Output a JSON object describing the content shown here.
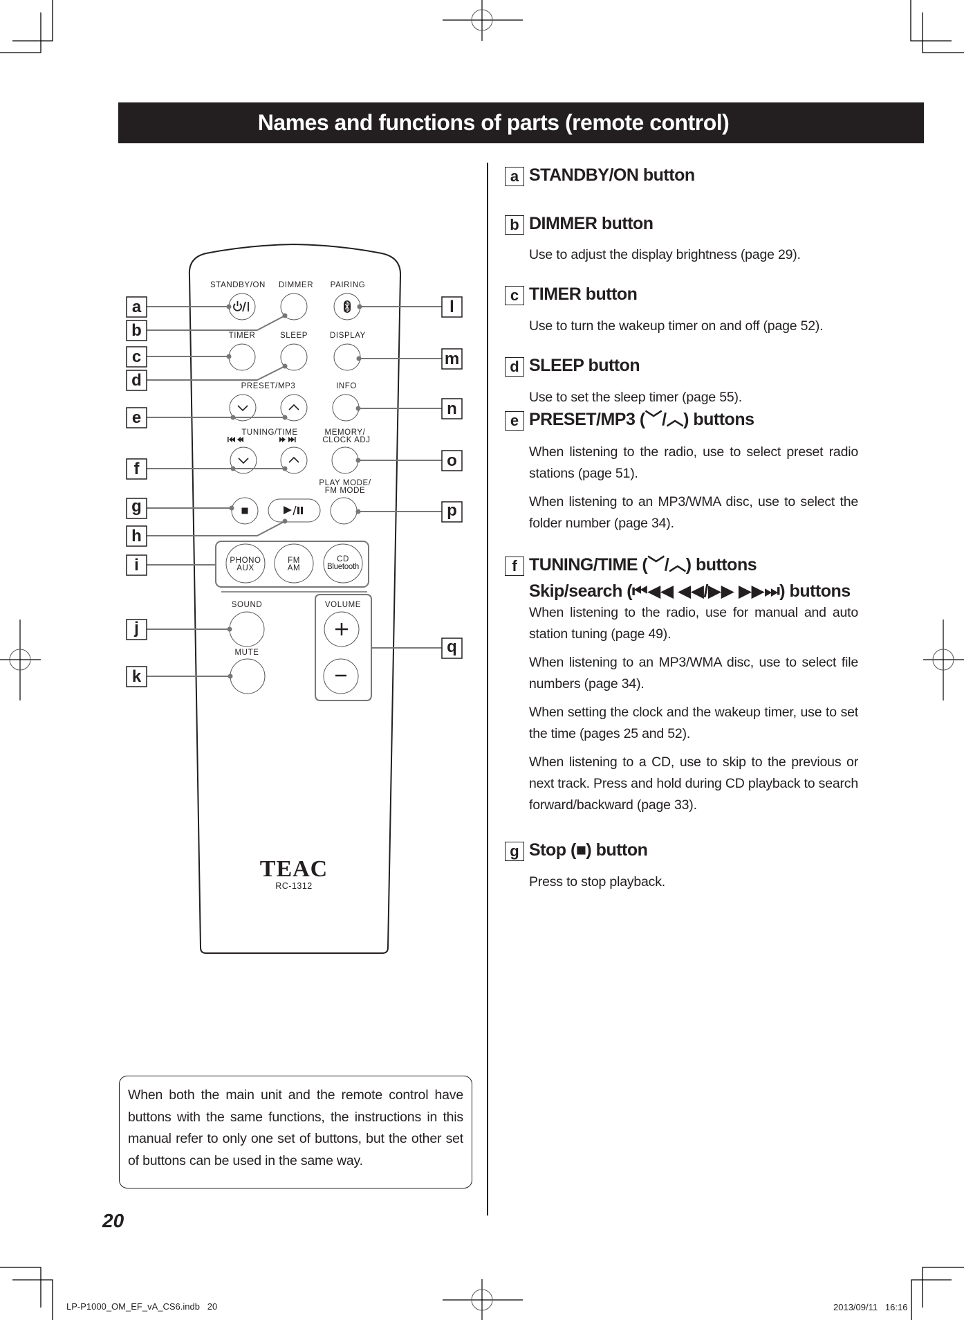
{
  "header": {
    "title": "Names and functions of parts (remote control)"
  },
  "remote": {
    "brand": "TEAC",
    "model": "RC-1312",
    "button_labels": {
      "standby_on": "STANDBY/ON",
      "dimmer": "DIMMER",
      "pairing": "PAIRING",
      "timer": "TIMER",
      "sleep": "SLEEP",
      "display": "DISPLAY",
      "preset_mp3": "PRESET/MP3",
      "info": "INFO",
      "tuning_time": "TUNING/TIME",
      "memory_clock_adj_1": "MEMORY/",
      "memory_clock_adj_2": "CLOCK ADJ",
      "play_mode_1": "PLAY MODE/",
      "play_mode_2": "FM MODE",
      "sound": "SOUND",
      "mute": "MUTE",
      "volume": "VOLUME",
      "phono_1": "PHONO",
      "phono_2": "AUX",
      "fm_1": "FM",
      "fm_2": "AM",
      "cd_1": "CD",
      "cd_2": "Bluetooth",
      "standby_glyph": "⏻/I",
      "skip_back_glyph": "⏮ ◀◀",
      "skip_fwd_glyph": "▶▶ ⏭",
      "play_pause_glyph": "▶/II",
      "plus_glyph": "+",
      "minus_glyph": "−"
    },
    "callouts": {
      "a": "a",
      "b": "b",
      "c": "c",
      "d": "d",
      "e": "e",
      "f": "f",
      "g": "g",
      "h": "h",
      "i": "i",
      "j": "j",
      "k": "k",
      "l": "l",
      "m": "m",
      "n": "n",
      "o": "o",
      "p": "p",
      "q": "q"
    }
  },
  "items": [
    {
      "letter": "a",
      "heading": "STANDBY/ON button",
      "body": []
    },
    {
      "letter": "b",
      "heading": "DIMMER button",
      "body": [
        "Use to adjust the display brightness (page 29)."
      ]
    },
    {
      "letter": "c",
      "heading": "TIMER button",
      "body": [
        "Use to turn the wakeup timer on and off (page 52)."
      ]
    },
    {
      "letter": "d",
      "heading": "SLEEP button",
      "body": [
        "Use to set the sleep timer (page 55)."
      ]
    },
    {
      "letter": "e",
      "heading": " PRESET/MP3 (﹀/︿) buttons",
      "body": [
        "When listening to the radio, use to select preset radio stations (page 51).",
        "When listening to an MP3/WMA disc, use to select the folder number (page 34)."
      ]
    },
    {
      "letter": "f",
      "heading": "TUNING/TIME (﹀/︿) buttons",
      "heading2": "Skip/search (⏮◀◀ ◀◀/▶▶ ▶▶⏭) buttons",
      "body": [
        "When listening to the radio, use for manual and auto station tuning (page 49).",
        "When listening to an MP3/WMA disc, use to select file numbers (page 34).",
        "When setting the clock and the wakeup timer, use to set the time (pages 25 and 52).",
        "When listening to a CD, use to skip to the previous or next track. Press and hold during CD playback to search forward/backward (page 33)."
      ]
    },
    {
      "letter": "g",
      "heading": "Stop (■) button",
      "body": [
        "Press to stop playback."
      ]
    }
  ],
  "note": "When both the main unit and the remote control have buttons with the same functions, the instructions in this manual refer to only one set of buttons, but the other set of buttons can be used in the same way.",
  "page_number": "20",
  "footer": {
    "file": "LP-P1000_OM_EF_vA_CS6.indb   20",
    "date": "2013/09/11   16:16"
  }
}
